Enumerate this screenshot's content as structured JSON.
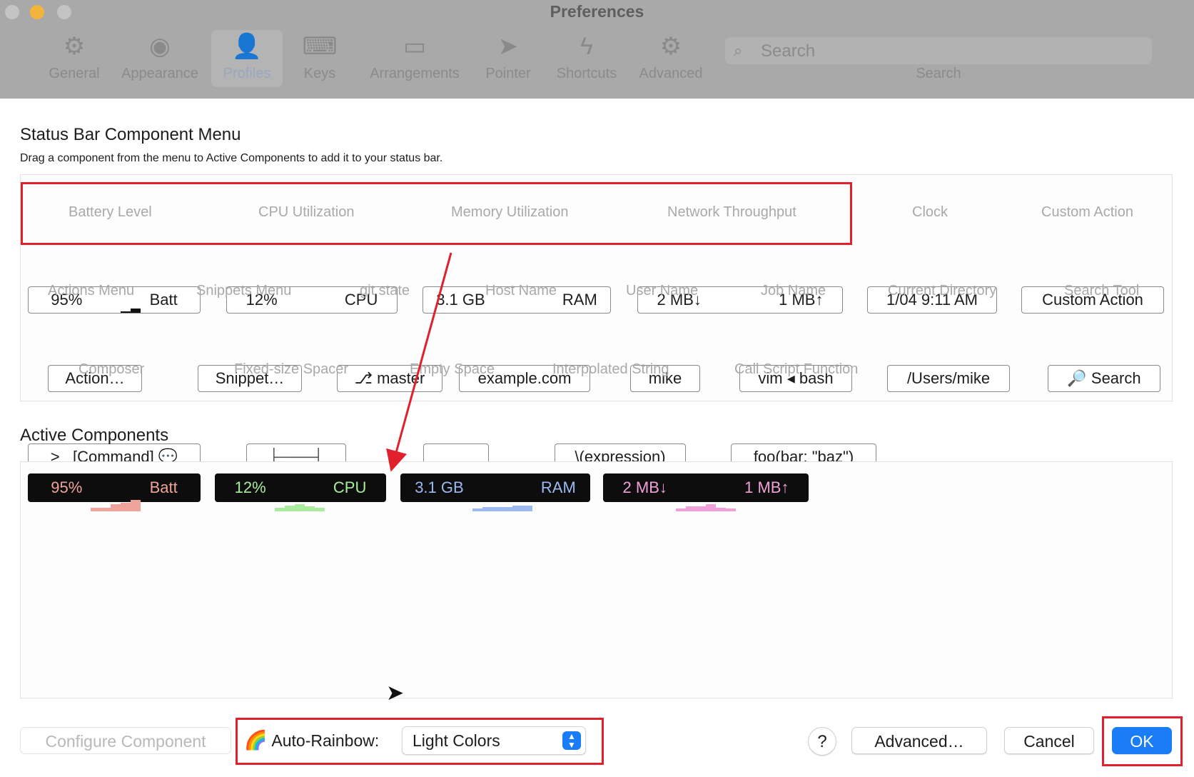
{
  "window": {
    "title": "Preferences"
  },
  "toolbar": {
    "items": [
      {
        "label": "General",
        "icon": "gear-icon"
      },
      {
        "label": "Appearance",
        "icon": "eye-icon"
      },
      {
        "label": "Profiles",
        "icon": "person-icon",
        "selected": true
      },
      {
        "label": "Keys",
        "icon": "keyboard-icon"
      },
      {
        "label": "Arrangements",
        "icon": "window-icon"
      },
      {
        "label": "Pointer",
        "icon": "pointer-icon"
      },
      {
        "label": "Shortcuts",
        "icon": "bolt-icon"
      },
      {
        "label": "Advanced",
        "icon": "gears-icon"
      }
    ],
    "search_placeholder": "Search",
    "search_label": "Search"
  },
  "menu": {
    "title": "Status Bar Component Menu",
    "description": "Drag a component from the menu to Active Components to add it to your status bar.",
    "components": [
      {
        "left": "95%",
        "right": "Batt",
        "label": "Battery Level"
      },
      {
        "left": "12%",
        "right": "CPU",
        "label": "CPU Utilization"
      },
      {
        "left": "3.1 GB",
        "right": "RAM",
        "label": "Memory Utilization"
      },
      {
        "left": "2 MB↓",
        "right": "1 MB↑",
        "label": "Network Throughput"
      },
      {
        "text": "1/04 9:11 AM",
        "label": "Clock"
      },
      {
        "text": "Custom Action",
        "label": "Custom Action"
      },
      {
        "text": "Action…",
        "label": "Actions Menu"
      },
      {
        "text": "Snippet…",
        "label": "Snippets Menu"
      },
      {
        "text": "⎇ master",
        "label": "git state"
      },
      {
        "text": "example.com",
        "label": "Host Name"
      },
      {
        "text": "mike",
        "label": "User Name"
      },
      {
        "text": "vim ◂ bash",
        "label": "Job Name"
      },
      {
        "text": "/Users/mike",
        "label": "Current Directory"
      },
      {
        "text": "🔎 Search",
        "label": "Search Tool"
      },
      {
        "text": ">_ [Command] 💬",
        "label": "Composer"
      },
      {
        "text": "├───┤",
        "label": "Fixed-size Spacer"
      },
      {
        "text": "",
        "label": "Empty Space"
      },
      {
        "text": "\\(expression)",
        "label": "Interpolated String"
      },
      {
        "text": "foo(bar: \"baz\")",
        "label": "Call Script Function"
      }
    ]
  },
  "active": {
    "title": "Active Components",
    "chips": [
      {
        "left": "95%",
        "right": "Batt",
        "color": "#f0a39a"
      },
      {
        "left": "12%",
        "right": "CPU",
        "color": "#a9ec9d"
      },
      {
        "left": "3.1 GB",
        "right": "RAM",
        "color": "#9cb9f2"
      },
      {
        "left": "2 MB↓",
        "right": "1 MB↑",
        "color": "#f0a0d8"
      }
    ]
  },
  "bottom": {
    "configure_label": "Configure Component",
    "rainbow_label": "Auto-Rainbow:",
    "rainbow_value": "Light Colors",
    "help_label": "?",
    "advanced_label": "Advanced…",
    "cancel_label": "Cancel",
    "ok_label": "OK"
  },
  "colors": {
    "annotation": "#e0202a",
    "accent": "#1a7cf6"
  }
}
